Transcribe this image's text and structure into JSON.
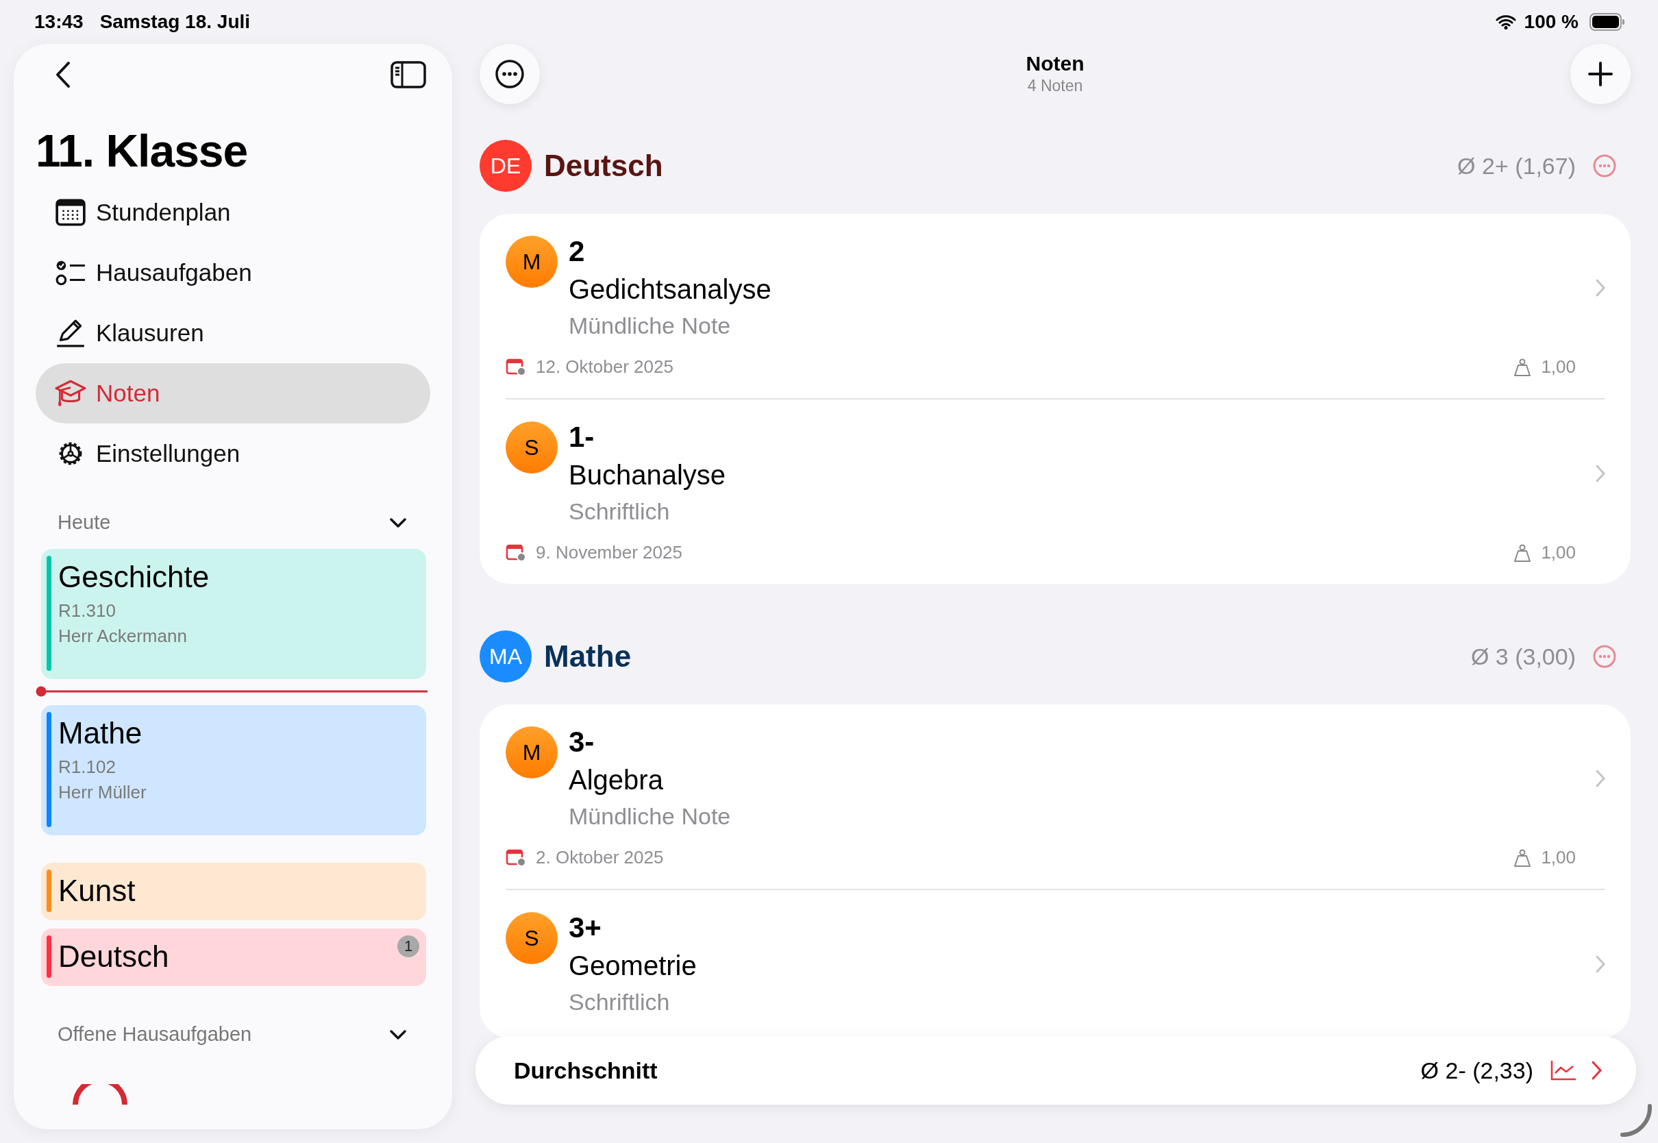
{
  "status_bar": {
    "time": "13:43",
    "date": "Samstag 18. Juli",
    "battery": "100 %"
  },
  "sidebar": {
    "title": "11. Klasse",
    "items": [
      {
        "label": "Stundenplan",
        "kind": "calendar",
        "selected": false
      },
      {
        "label": "Hausaufgaben",
        "kind": "checklist",
        "selected": false
      },
      {
        "label": "Klausuren",
        "kind": "pencil",
        "selected": false
      },
      {
        "label": "Noten",
        "kind": "graduation",
        "selected": true
      },
      {
        "label": "Einstellungen",
        "kind": "gear",
        "selected": false
      }
    ],
    "today": {
      "heading": "Heute",
      "lessons": [
        {
          "subject": "Geschichte",
          "room": "R1.310",
          "teacher": "Herr Ackermann",
          "color": "#00c7a8",
          "current_time_after": true
        },
        {
          "subject": "Mathe",
          "room": "R1.102",
          "teacher": "Herr Müller",
          "color": "#0a84ff",
          "current_time_after": false
        },
        {
          "subject": "Kunst",
          "color": "#ff8c1a",
          "current_time_after": false
        },
        {
          "subject": "Deutsch",
          "color": "#ff3040",
          "badge": "1",
          "current_time_after": false
        }
      ]
    },
    "open_homework": {
      "heading": "Offene Hausaufgaben"
    }
  },
  "header": {
    "title": "Noten",
    "subtitle": "4 Noten"
  },
  "subjects": [
    {
      "code": "DE",
      "name": "Deutsch",
      "color": "#ff3b30",
      "average": "Ø 2+ (1,67)",
      "grades": [
        {
          "type_letter": "M",
          "grade": "2",
          "title": "Gedichtsanalyse",
          "type": "Mündliche Note",
          "date": "12. Oktober 2025",
          "weight": "1,00"
        },
        {
          "type_letter": "S",
          "grade": "1-",
          "title": "Buchanalyse",
          "type": "Schriftlich",
          "date": "9. November 2025",
          "weight": "1,00"
        }
      ]
    },
    {
      "code": "MA",
      "name": "Mathe",
      "color": "#1a8cff",
      "average": "Ø 3 (3,00)",
      "grades": [
        {
          "type_letter": "M",
          "grade": "3-",
          "title": "Algebra",
          "type": "Mündliche Note",
          "date": "2. Oktober 2025",
          "weight": "1,00"
        },
        {
          "type_letter": "S",
          "grade": "3+",
          "title": "Geometrie",
          "type": "Schriftlich"
        }
      ]
    }
  ],
  "summary": {
    "label": "Durchschnitt",
    "average": "Ø 2- (2,33)"
  }
}
